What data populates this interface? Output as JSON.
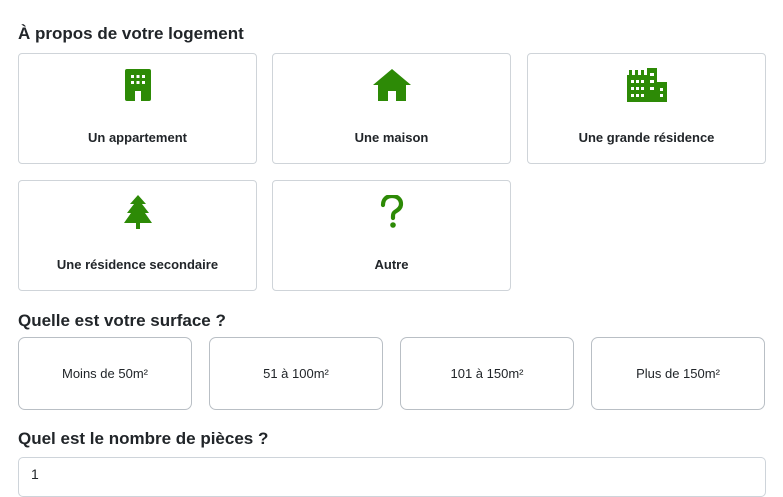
{
  "housing": {
    "title": "À propos de votre logement",
    "options": [
      {
        "label": "Un appartement",
        "icon": "building-icon"
      },
      {
        "label": "Une maison",
        "icon": "house-icon"
      },
      {
        "label": "Une grande résidence",
        "icon": "city-icon"
      },
      {
        "label": "Une résidence secondaire",
        "icon": "tree-icon"
      },
      {
        "label": "Autre",
        "icon": "question-icon"
      }
    ]
  },
  "surface": {
    "title": "Quelle est votre surface ?",
    "options": [
      "Moins de 50m²",
      "51 à 100m²",
      "101 à 150m²",
      "Plus de 150m²"
    ]
  },
  "rooms": {
    "title": "Quel est le nombre de pièces ?",
    "value": "1"
  },
  "colors": {
    "icon_green": "#2d8a06",
    "border": "#cfd4d9",
    "text": "#212529"
  }
}
